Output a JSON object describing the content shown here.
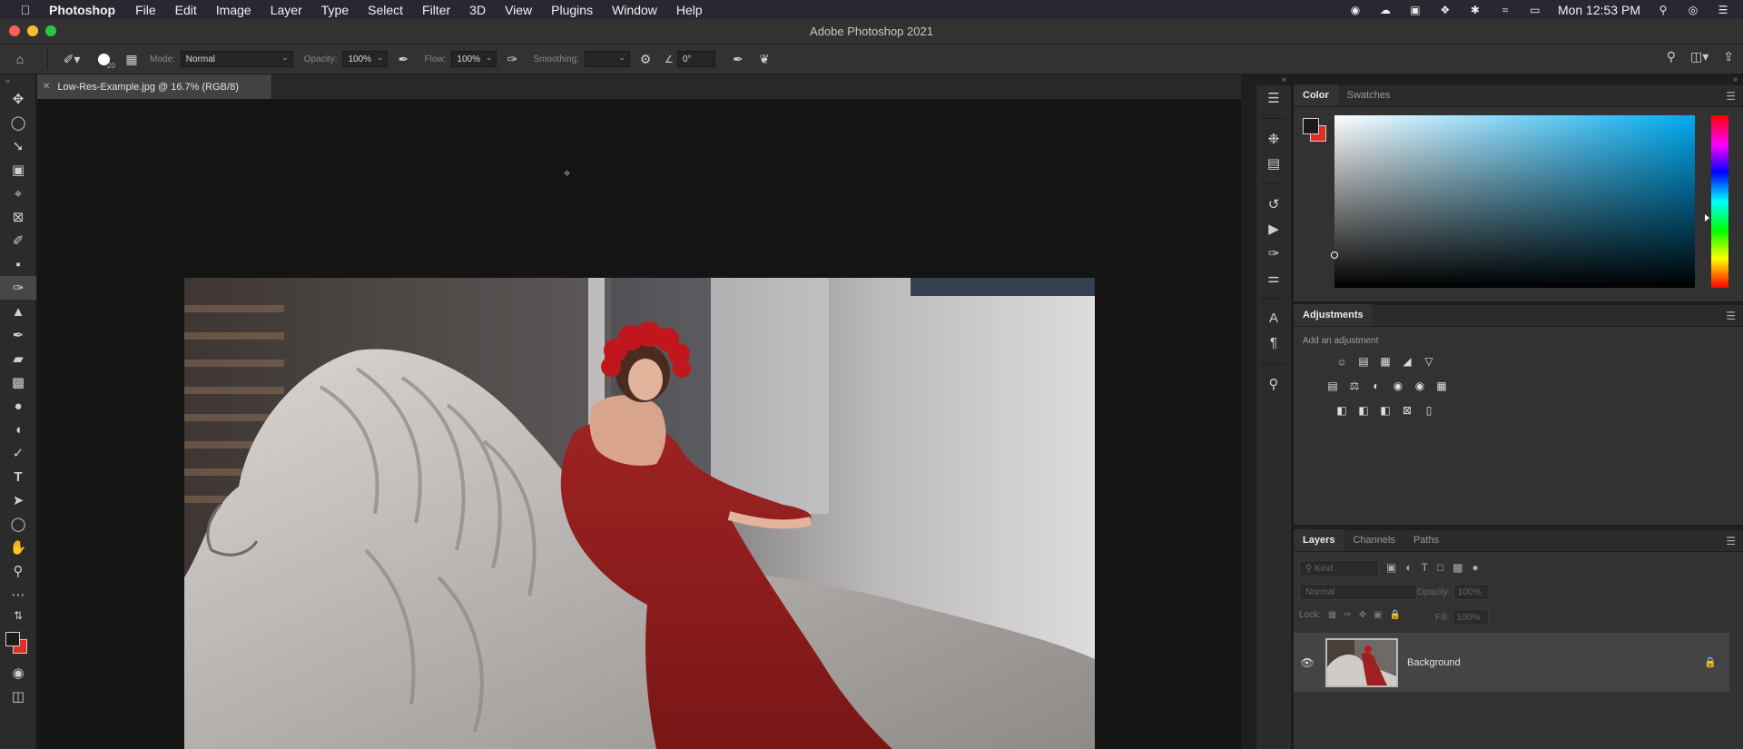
{
  "menubar": {
    "app_name": "Photoshop",
    "items": [
      "File",
      "Edit",
      "Image",
      "Layer",
      "Type",
      "Select",
      "Filter",
      "3D",
      "View",
      "Plugins",
      "Window",
      "Help"
    ],
    "clock": "Mon 12:53 PM"
  },
  "window": {
    "title": "Adobe Photoshop 2021"
  },
  "options": {
    "brush_size": "20",
    "mode_label": "Mode:",
    "mode_value": "Normal",
    "opacity_label": "Opacity:",
    "opacity_value": "100%",
    "flow_label": "Flow:",
    "flow_value": "100%",
    "smoothing_label": "Smoothing:",
    "smoothing_value": "",
    "angle_value": "0°"
  },
  "document": {
    "tab_title": "Low-Res-Example.jpg @ 16.7% (RGB/8)"
  },
  "color_panel": {
    "tabs": [
      "Color",
      "Swatches"
    ],
    "foreground": "#1a1a1a",
    "background": "#e02f25",
    "hue_color": "#00aaf0"
  },
  "adjustments_panel": {
    "tab": "Adjustments",
    "hint": "Add an adjustment"
  },
  "layers_panel": {
    "tabs": [
      "Layers",
      "Channels",
      "Paths"
    ],
    "kind_placeholder": "Kind",
    "blend_mode": "Normal",
    "opacity_label": "Opacity:",
    "opacity_value": "100%",
    "lock_label": "Lock:",
    "fill_label": "Fill:",
    "fill_value": "100%",
    "layers": [
      {
        "name": "Background",
        "visible": true,
        "locked": true
      }
    ]
  }
}
